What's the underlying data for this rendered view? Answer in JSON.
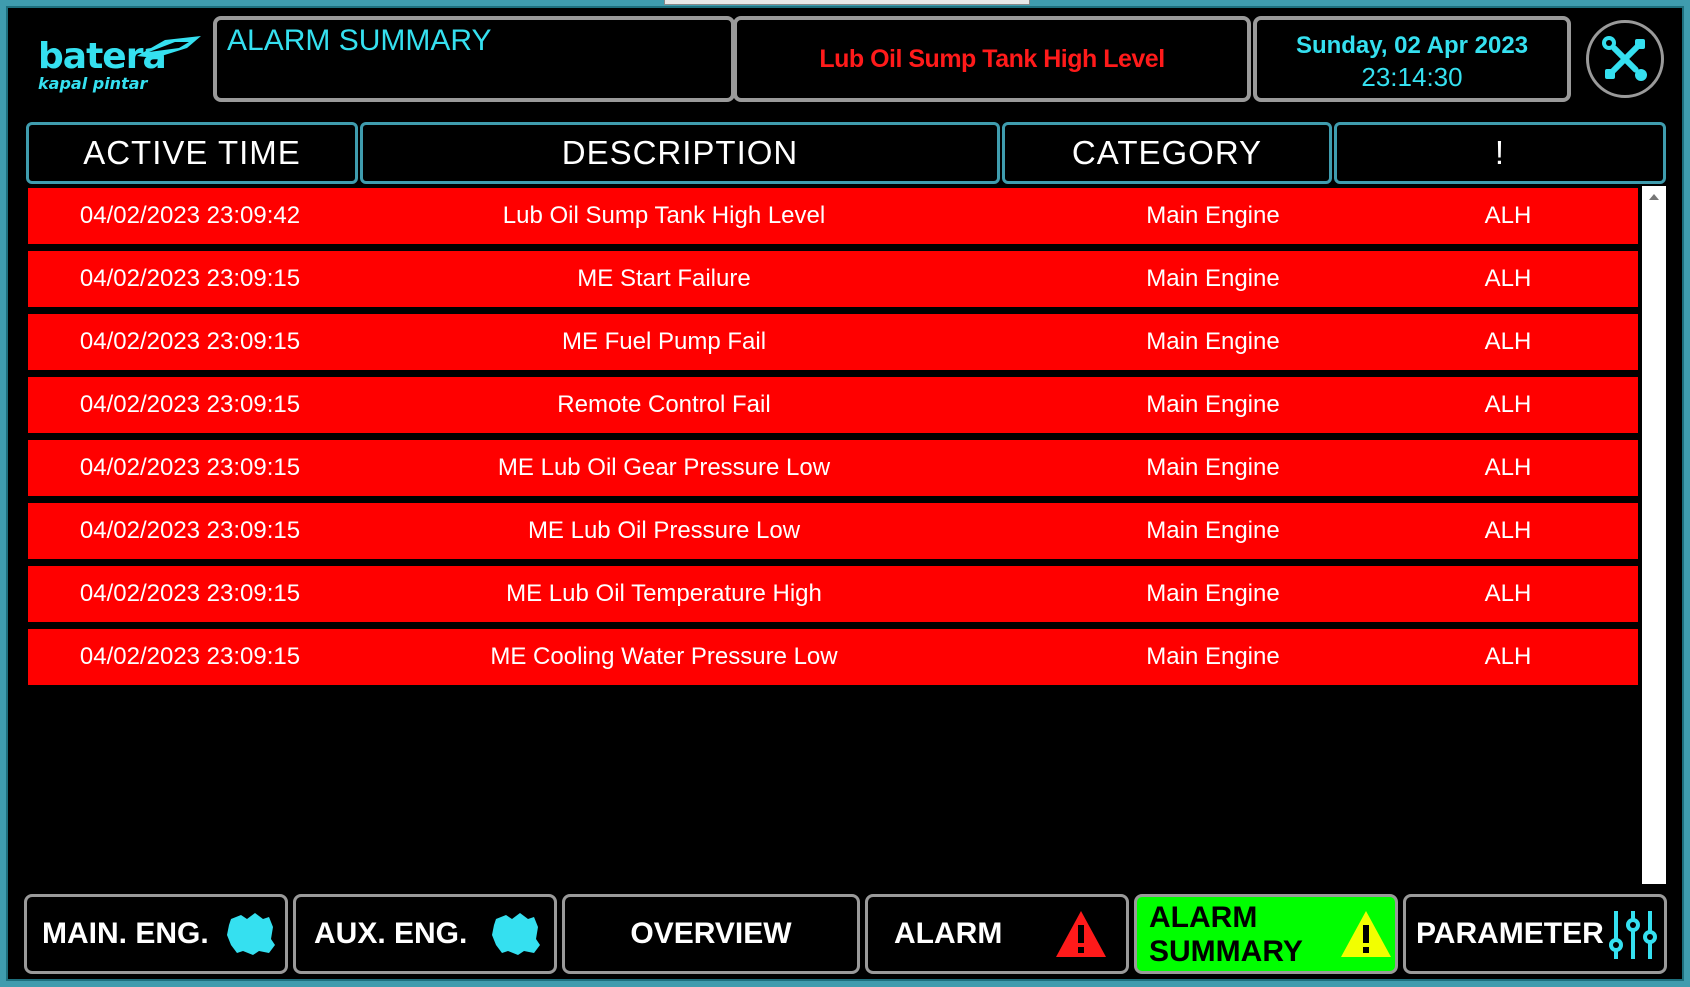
{
  "header": {
    "logo_main": "batera",
    "logo_sub": "kapal pintar",
    "page_title": "ALARM SUMMARY",
    "current_alarm": "Lub Oil Sump Tank High Level",
    "date": "Sunday, 02 Apr 2023",
    "time": "23:14:30"
  },
  "table": {
    "headers": [
      "ACTIVE TIME",
      "DESCRIPTION",
      "CATEGORY",
      "!"
    ],
    "rows": [
      {
        "time": "04/02/2023 23:09:42",
        "description": "Lub Oil Sump Tank High Level",
        "category": "Main Engine",
        "flag": "ALH"
      },
      {
        "time": "04/02/2023 23:09:15",
        "description": "ME Start Failure",
        "category": "Main Engine",
        "flag": "ALH"
      },
      {
        "time": "04/02/2023 23:09:15",
        "description": "ME Fuel Pump Fail",
        "category": "Main Engine",
        "flag": "ALH"
      },
      {
        "time": "04/02/2023 23:09:15",
        "description": "Remote Control Fail",
        "category": "Main Engine",
        "flag": "ALH"
      },
      {
        "time": "04/02/2023 23:09:15",
        "description": "ME Lub Oil Gear Pressure Low",
        "category": "Main Engine",
        "flag": "ALH"
      },
      {
        "time": "04/02/2023 23:09:15",
        "description": "ME Lub Oil Pressure Low",
        "category": "Main Engine",
        "flag": "ALH"
      },
      {
        "time": "04/02/2023 23:09:15",
        "description": "ME Lub Oil Temperature High",
        "category": "Main Engine",
        "flag": "ALH"
      },
      {
        "time": "04/02/2023 23:09:15",
        "description": "ME Cooling Water Pressure Low",
        "category": "Main Engine",
        "flag": "ALH"
      }
    ]
  },
  "nav": {
    "main_eng": "MAIN. ENG.",
    "aux_eng": "AUX. ENG.",
    "overview": "OVERVIEW",
    "alarm": "ALARM",
    "alarm_summary_1": "ALARM",
    "alarm_summary_2": "SUMMARY",
    "parameter": "PARAMETER"
  },
  "colors": {
    "alarm_row": "#ff0000",
    "accent": "#35e0f0",
    "active_nav": "#00ff00",
    "frame": "#3f9cae"
  }
}
